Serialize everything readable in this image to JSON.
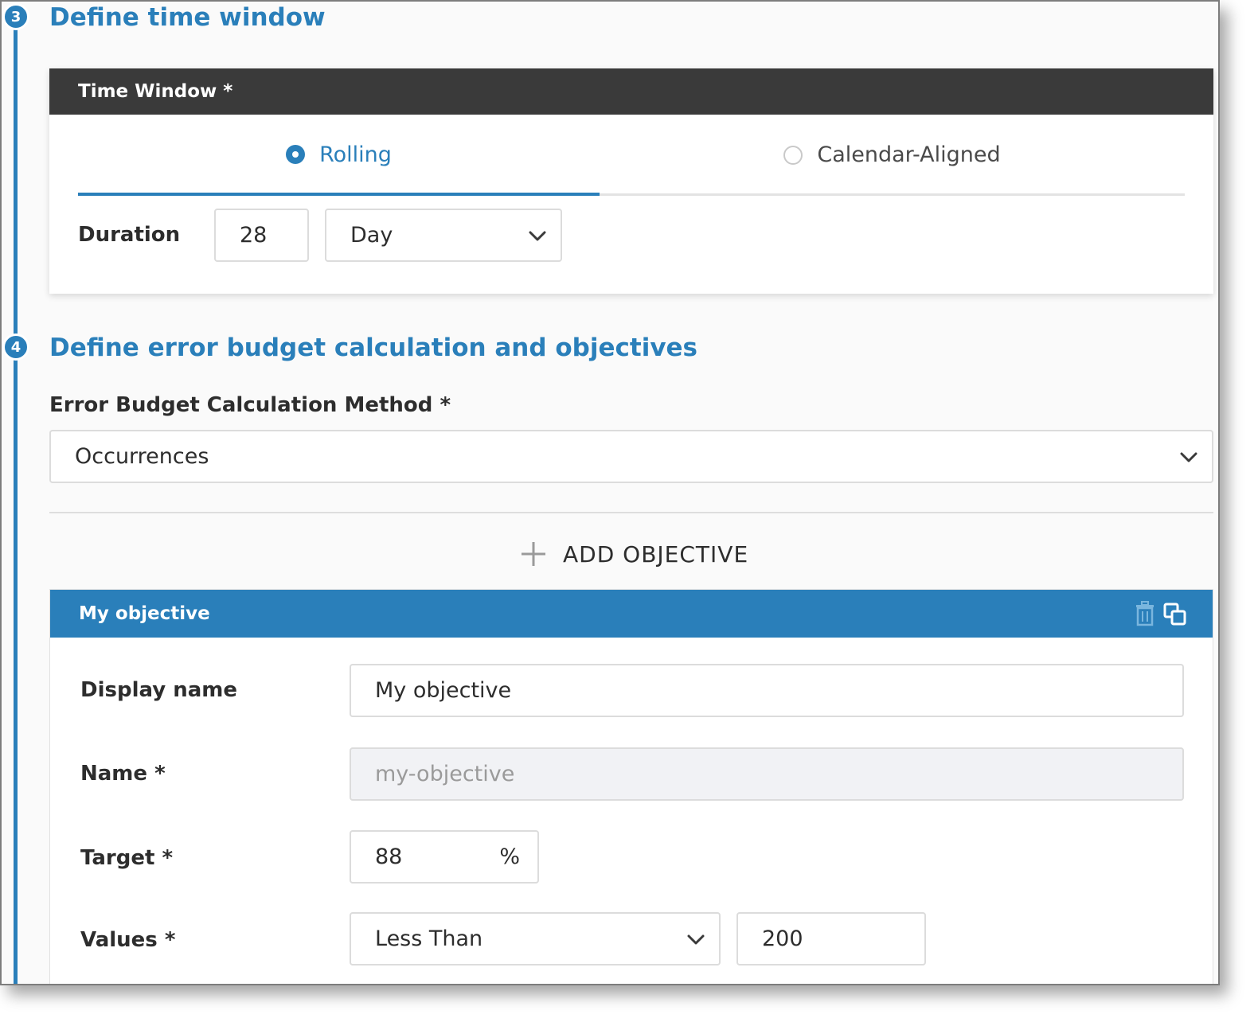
{
  "steps": {
    "time_window": {
      "number": "3",
      "title": "Define time window"
    },
    "error_budget": {
      "number": "4",
      "title": "Define error budget calculation and objectives"
    }
  },
  "time_window": {
    "header": "Time Window *",
    "tabs": [
      {
        "label": "Rolling",
        "selected": true
      },
      {
        "label": "Calendar-Aligned",
        "selected": false
      }
    ],
    "duration": {
      "label": "Duration",
      "value": "28",
      "unit": "Day"
    }
  },
  "error_budget": {
    "method_label": "Error Budget Calculation Method *",
    "method_value": "Occurrences",
    "add_objective_label": "ADD OBJECTIVE"
  },
  "objective": {
    "header": "My objective",
    "display_name": {
      "label": "Display name",
      "value": "My objective"
    },
    "name": {
      "label": "Name *",
      "value": "my-objective"
    },
    "target": {
      "label": "Target *",
      "value": "88",
      "suffix": "%"
    },
    "values": {
      "label": "Values *",
      "operator": "Less Than",
      "threshold": "200"
    }
  },
  "colors": {
    "accent": "#2a7fba",
    "header_dark": "#3a3a3a"
  },
  "icons": [
    "chevron-down-icon",
    "plus-icon",
    "trash-icon",
    "clone-icon"
  ]
}
